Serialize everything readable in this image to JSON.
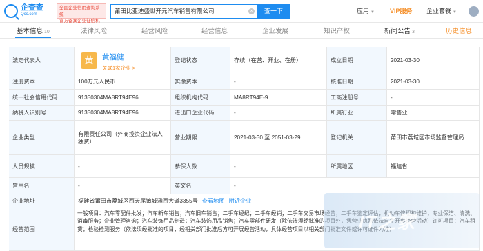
{
  "header": {
    "logo_title": "企查查",
    "logo_sub": "Qcc.com",
    "badge_line1": "全国企业信用查询系统",
    "badge_line2": "官方备案企业征信机构",
    "search_value": "莆田比亚迪盛世开元汽车销售有限公司",
    "search_button": "查一下",
    "nav": {
      "app": "应用",
      "vip": "VIP服务",
      "package": "企业套餐"
    }
  },
  "tabs": [
    {
      "label": "基本信息",
      "count": "10"
    },
    {
      "label": "法律风险",
      "count": ""
    },
    {
      "label": "经营风险",
      "count": ""
    },
    {
      "label": "经营信息",
      "count": ""
    },
    {
      "label": "企业发展",
      "count": ""
    },
    {
      "label": "知识产权",
      "count": ""
    },
    {
      "label": "新闻公告",
      "count": "3"
    },
    {
      "label": "历史信息",
      "count": ""
    }
  ],
  "info": {
    "rep_label": "法定代表人",
    "rep_avatar_char": "黄",
    "rep_name": "黄福健",
    "rep_related": "关联1家企业 >",
    "status_label": "登记状态",
    "status_value": "存续（在营、开业、在册）",
    "found_label": "成立日期",
    "found_value": "2021-03-30",
    "capital_label": "注册资本",
    "capital_value": "100万元人民币",
    "paid_label": "实缴资本",
    "paid_value": "-",
    "approve_label": "核准日期",
    "approve_value": "2021-03-30",
    "credit_label": "统一社会信用代码",
    "credit_value": "91350304MA8RT94E96",
    "org_label": "组织机构代码",
    "org_value": "MA8RT94E-9",
    "reg_no_label": "工商注册号",
    "reg_no_value": "-",
    "tax_label": "纳税人识别号",
    "tax_value": "91350304MA8RT94E96",
    "imp_label": "进出口企业代码",
    "imp_value": "-",
    "industry_label": "所属行业",
    "industry_value": "零售业",
    "type_label": "企业类型",
    "type_value": "有限责任公司（外商投资企业法人独资）",
    "term_label": "营业期限",
    "term_value": "2021-03-30 至 2051-03-29",
    "authority_label": "登记机关",
    "authority_value": "莆田市荔城区市场监督管理局",
    "staff_label": "人员规模",
    "staff_value": "-",
    "insured_label": "参保人数",
    "insured_value": "-",
    "region_label": "所属地区",
    "region_value": "福建省",
    "former_label": "曾用名",
    "former_value": "-",
    "en_label": "英文名",
    "en_value": "-",
    "address_label": "企业地址",
    "address_value": "福建省莆田市荔城区西天尾镇城涵西大道3355号",
    "map_link": "查看地图",
    "nearby_link": "附近企业",
    "scope_label": "经营范围",
    "scope_value": "一般项目：汽车零配件批发；汽车新车销售；汽车旧车销售；二手车经纪；二手车经销；二手车交易市场经营；二手车鉴定评估；机动车修理和维护；专业保洁、清洗、消毒服务；企业管理咨询；汽车装饰用品制造；汽车装饰用品销售；汽车零部件研发（除依法须经批准的项目外，凭营业执照依法自主开展经营活动）许可项目：汽车租赁；检验检测服务（依法须经批准的项目，经相关部门批准后方可开展经营活动，具体经营项目以相关部门批准文件或许可证件为准）"
  },
  "watermark_text": "IT之家"
}
